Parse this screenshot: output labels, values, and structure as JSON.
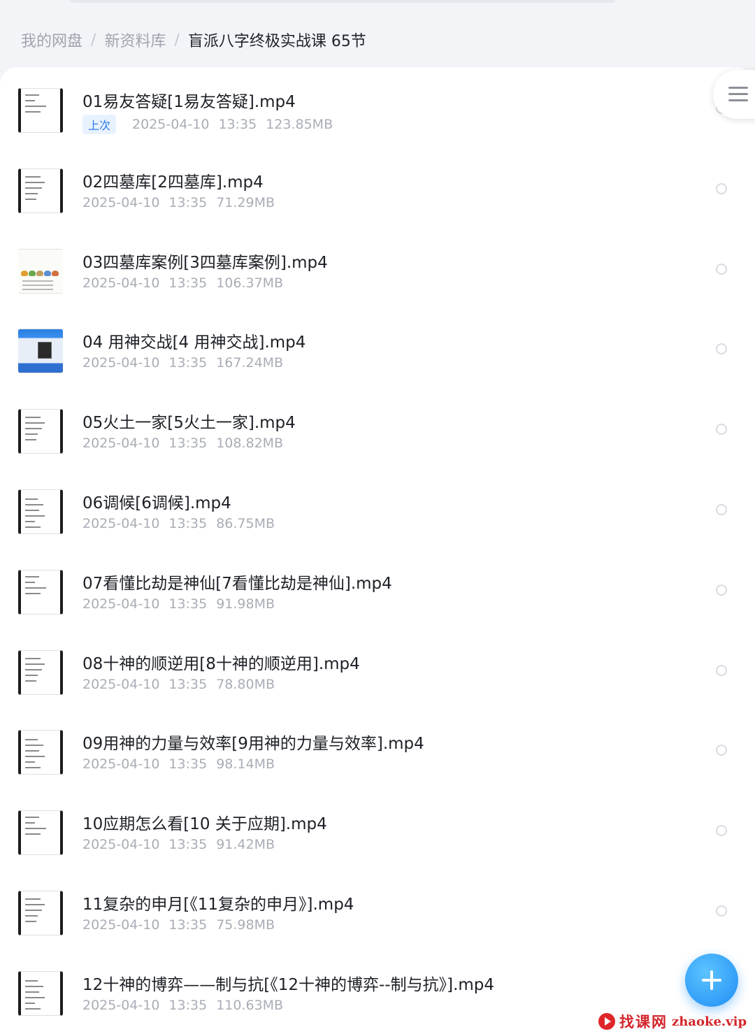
{
  "breadcrumb": {
    "root": "我的网盘",
    "parent": "新资料库",
    "current": "盲派八字终极实战课 65节",
    "separator": "/"
  },
  "files": [
    {
      "name": "01易友答疑[1易友答疑].mp4",
      "badge": "上次",
      "date": "2025-04-10",
      "time": "13:35",
      "size": "123.85MB",
      "thumb": "doc"
    },
    {
      "name": "02四墓库[2四墓库].mp4",
      "date": "2025-04-10",
      "time": "13:35",
      "size": "71.29MB",
      "thumb": "doc"
    },
    {
      "name": "03四墓库案例[3四墓库案例].mp4",
      "date": "2025-04-10",
      "time": "13:35",
      "size": "106.37MB",
      "thumb": "chart"
    },
    {
      "name": "04 用神交战[4 用神交战].mp4",
      "date": "2025-04-10",
      "time": "13:35",
      "size": "167.24MB",
      "thumb": "desktop"
    },
    {
      "name": "05火土一家[5火土一家].mp4",
      "date": "2025-04-10",
      "time": "13:35",
      "size": "108.82MB",
      "thumb": "doc"
    },
    {
      "name": "06调候[6调候].mp4",
      "date": "2025-04-10",
      "time": "13:35",
      "size": "86.75MB",
      "thumb": "doc"
    },
    {
      "name": "07看懂比劫是神仙[7看懂比劫是神仙].mp4",
      "date": "2025-04-10",
      "time": "13:35",
      "size": "91.98MB",
      "thumb": "doc"
    },
    {
      "name": "08十神的顺逆用[8十神的顺逆用].mp4",
      "date": "2025-04-10",
      "time": "13:35",
      "size": "78.80MB",
      "thumb": "doc"
    },
    {
      "name": "09用神的力量与效率[9用神的力量与效率].mp4",
      "date": "2025-04-10",
      "time": "13:35",
      "size": "98.14MB",
      "thumb": "doc"
    },
    {
      "name": "10应期怎么看[10 关于应期].mp4",
      "date": "2025-04-10",
      "time": "13:35",
      "size": "91.42MB",
      "thumb": "doc"
    },
    {
      "name": "11复杂的申月[《11复杂的申月》].mp4",
      "date": "2025-04-10",
      "time": "13:35",
      "size": "75.98MB",
      "thumb": "doc"
    },
    {
      "name": "12十神的博弈——制与抗[《12十神的博弈--制与抗》].mp4",
      "date": "2025-04-10",
      "time": "13:35",
      "size": "110.63MB",
      "thumb": "doc"
    }
  ],
  "icons": {
    "menu": "menu-icon",
    "add": "plus-icon",
    "select": "radio-circle-icon"
  },
  "watermark": {
    "cn": "找课网",
    "en": "zhaoke.vip"
  },
  "colors": {
    "accent": "#1f8ef5",
    "badge_text": "#2d79e8",
    "badge_bg": "#e8f2ff",
    "watermark": "#d2262c"
  }
}
